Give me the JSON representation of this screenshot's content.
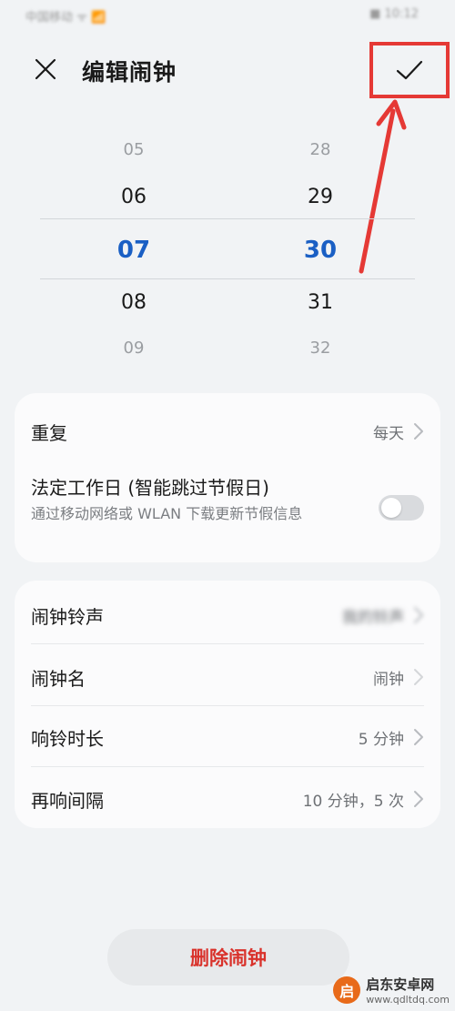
{
  "status_bar": {
    "carrier": "中国移动 ᯤ 📶",
    "right": "■ 10:12"
  },
  "header": {
    "title": "编辑闹钟"
  },
  "picker": {
    "hours": [
      "05",
      "06",
      "07",
      "08",
      "09"
    ],
    "minutes": [
      "28",
      "29",
      "30",
      "31",
      "32"
    ],
    "selected_hour": "07",
    "selected_minute": "30"
  },
  "settings_card_1": {
    "repeat": {
      "label": "重复",
      "value": "每天"
    },
    "workday": {
      "label": "法定工作日 (智能跳过节假日)",
      "desc": "通过移动网络或 WLAN 下载更新节假信息",
      "enabled": false
    }
  },
  "settings_card_2": {
    "ringtone": {
      "label": "闹钟铃声",
      "value": "我的铃声"
    },
    "name": {
      "label": "闹钟名",
      "value": "闹钟"
    },
    "duration": {
      "label": "响铃时长",
      "value": "5 分钟"
    },
    "snooze": {
      "label": "再响间隔",
      "value": "10 分钟，5 次"
    }
  },
  "delete_label": "删除闹钟",
  "watermark": {
    "logo": "启",
    "name": "启东安卓网",
    "url": "www.qdltdq.com"
  },
  "colors": {
    "accent": "#1a5fc4",
    "delete": "#d9322b",
    "highlight": "#e53935"
  },
  "icons": {
    "close": "close-icon",
    "confirm": "check-icon",
    "chevron": "chevron-right-icon"
  }
}
